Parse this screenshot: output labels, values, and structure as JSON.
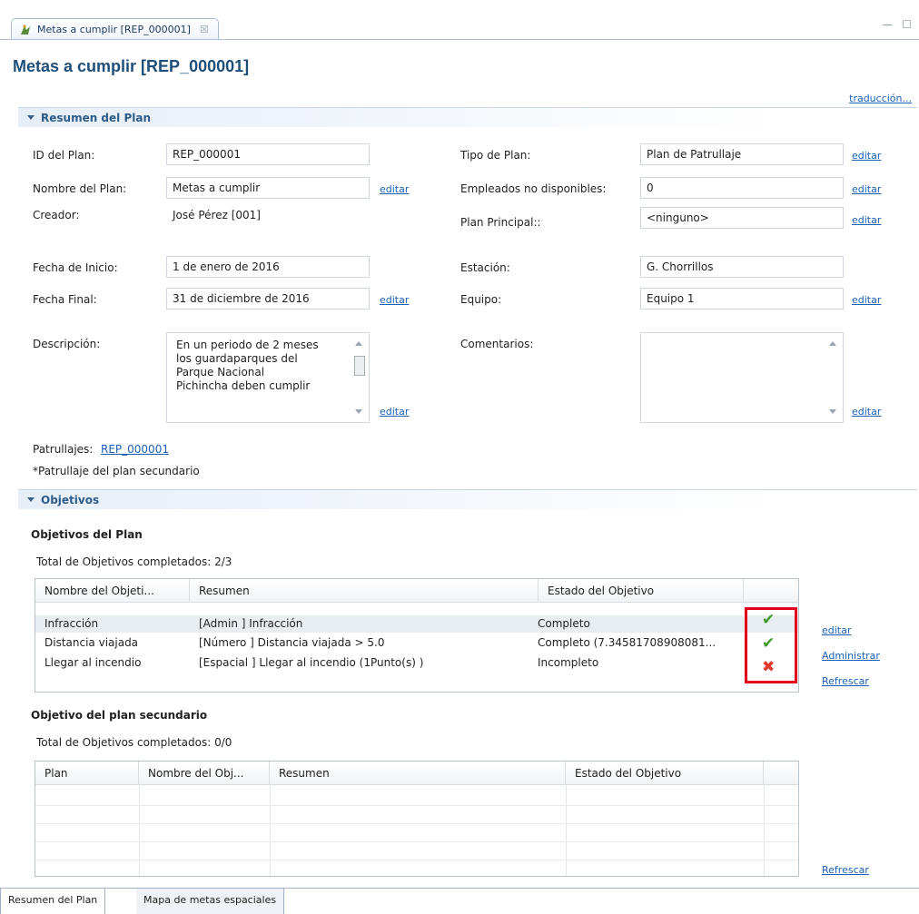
{
  "editor_tab": {
    "label": "Metas a cumplir [REP_000001]",
    "close": "☒"
  },
  "page": {
    "title": "Metas a cumplir [REP_000001]",
    "translate_link": "traducción..."
  },
  "plan_summary": {
    "section_title": "Resumen del Plan",
    "id_label": "ID del Plan:",
    "id_value": "REP_000001",
    "name_label": "Nombre del Plan:",
    "name_value": "Metas a cumplir",
    "name_edit": "editar",
    "creator_label": "Creador:",
    "creator_value": "José Pérez [001]",
    "start_label": "Fecha de Inicio:",
    "start_value": "1 de enero de 2016",
    "end_label": "Fecha Final:",
    "end_value": "31 de diciembre de 2016",
    "end_edit": "editar",
    "desc_label": "Descripción:",
    "desc_lines": [
      "En un periodo de 2 meses",
      "los guardaparques del",
      "Parque Nacional",
      "Pichincha deben cumplir"
    ],
    "desc_edit": "editar",
    "type_label": "Tipo de Plan:",
    "type_value": "Plan de Patrullaje",
    "type_edit": "editar",
    "unavail_label": "Empleados no disponibles:",
    "unavail_value": "0",
    "unavail_edit": "editar",
    "parent_label": "Plan Principal::",
    "parent_value": "<ninguno>",
    "parent_edit": "editar",
    "station_label": "Estación:",
    "station_value": "G. Chorrillos",
    "team_label": "Equipo:",
    "team_value": "Equipo 1",
    "team_edit": "editar",
    "comments_label": "Comentarios:",
    "comments_value": "",
    "comments_edit": "editar",
    "patrols_label": "Patrullajes:",
    "patrols_link": "REP_000001",
    "patrols_note": "*Patrullaje del plan secundario"
  },
  "objectives": {
    "section_title": "Objetivos",
    "plan_heading": "Objetivos del Plan",
    "plan_total": "Total de Objetivos completados: 2/3",
    "columns": [
      "Nombre del Objeti...",
      "Resumen",
      "Estado del Objetivo"
    ],
    "rows": [
      {
        "name": "Infracción",
        "summary": "[Admin ] Infracción",
        "status": "Completo",
        "icon": "check-icon"
      },
      {
        "name": "Distancia viajada",
        "summary": "[Número ] Distancia viajada  > 5.0",
        "status": "Completo  (7.34581708908081...",
        "icon": "check-icon"
      },
      {
        "name": "Llegar al incendio",
        "summary": "[Espacial ] Llegar al incendio  (1Punto(s) )",
        "status": "Incompleto",
        "icon": "cross-icon"
      }
    ],
    "icons": {
      "check": "✔",
      "cross": "✖"
    },
    "edit_link": "editar",
    "manage_link": "Administrar",
    "refresh_link": "Refrescar",
    "sub_heading": "Objetivo del plan secundario",
    "sub_total": "Total de Objetivos completados: 0/0",
    "sub_columns": [
      "Plan",
      "Nombre del Obj...",
      "Resumen",
      "Estado del Objetivo"
    ],
    "sub_refresh_link": "Refrescar"
  },
  "bottom_tabs": [
    "Resumen del Plan",
    "Mapa de metas espaciales"
  ],
  "colors": {
    "accent": "#1f4e79",
    "link": "#1a5fb4",
    "highlight": "#e2001a",
    "ok": "#3f9b2b",
    "fail": "#e23a2f"
  }
}
